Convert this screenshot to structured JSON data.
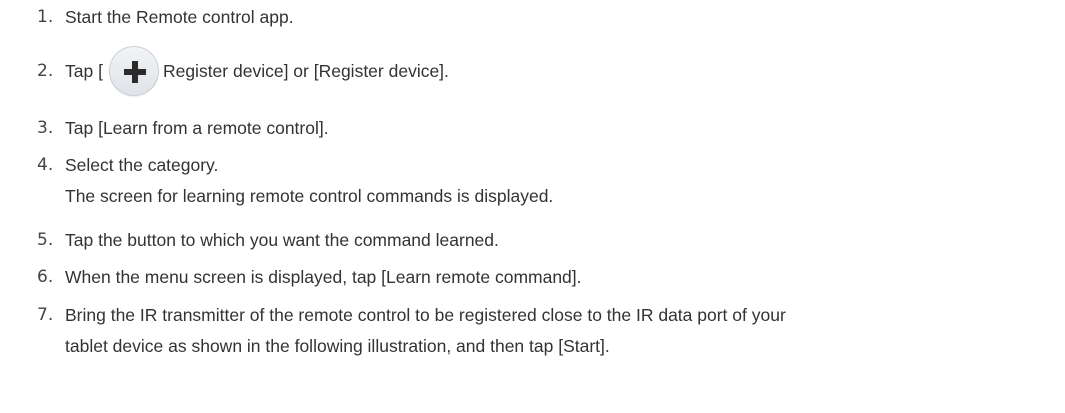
{
  "steps": [
    {
      "num": "1.",
      "text": "Start the Remote control app."
    },
    {
      "num": "2.",
      "before": "Tap [",
      "icon": "plus-icon",
      "after": "Register device] or [Register device]."
    },
    {
      "num": "3.",
      "text": "Tap [Learn from a remote control]."
    },
    {
      "num": "4.",
      "text": "Select the category.",
      "text2": "The screen for learning remote control commands is displayed."
    },
    {
      "num": "5.",
      "text": "Tap the button to which you want the command learned."
    },
    {
      "num": "6.",
      "text": "When the menu screen is displayed, tap [Learn remote command]."
    },
    {
      "num": "7.",
      "text": "Bring the IR transmitter of the remote control to be registered close to the IR data port of your",
      "text2": "tablet device as shown in the following illustration, and then tap [Start]."
    }
  ],
  "colors": {
    "text": "#333333",
    "plus_glyph": "#2b2b2b",
    "button_fill": "#e6e9ec"
  }
}
